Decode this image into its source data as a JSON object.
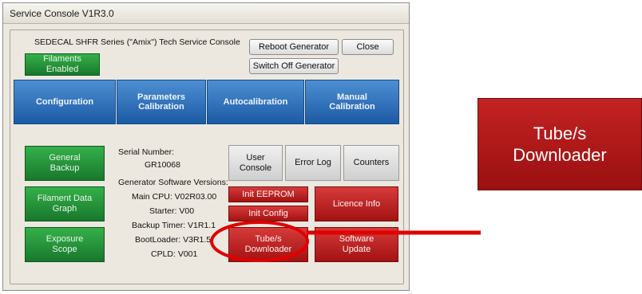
{
  "window": {
    "title": "Service Console V1R3.0",
    "heading": "SEDECAL SHFR Series (\"Amix\") Tech Service Console"
  },
  "top_buttons": {
    "filaments": "Filaments\nEnabled",
    "reboot": "Reboot Generator",
    "close": "Close",
    "switch_off": "Switch Off Generator"
  },
  "tabs": [
    {
      "label": "Configuration"
    },
    {
      "label": "Parameters\nCalibration"
    },
    {
      "label": "Autocalibration"
    },
    {
      "label": "Manual\nCalibration"
    }
  ],
  "left_buttons": {
    "general_backup": "General\nBackup",
    "filament_data_graph": "Filament Data\nGraph",
    "exposure_scope": "Exposure\nScope"
  },
  "info": {
    "serial_label": "Serial Number:",
    "serial_value": "GR10068",
    "versions_label": "Generator Software Versions:",
    "main_cpu": "Main CPU: V02R03.00",
    "starter": "Starter: V00",
    "backup_timer": "Backup Timer: V1R1.1",
    "bootloader": "BootLoader: V3R1.5",
    "cpld": "CPLD: V001"
  },
  "right_buttons": {
    "user_console": "User\nConsole",
    "error_log": "Error Log",
    "counters": "Counters",
    "init_eeprom": "Init EEPROM",
    "init_config": "Init Config",
    "licence_info": "Licence Info",
    "tube_downloader": "Tube/s\nDownloader",
    "software_update": "Software\nUpdate"
  },
  "zoom_callout": {
    "label": "Tube/s\nDownloader"
  },
  "colors": {
    "highlight_red": "#e00000",
    "green_button": "#239a3a",
    "blue_tab": "#2f6fba",
    "red_button": "#b81d1d"
  }
}
